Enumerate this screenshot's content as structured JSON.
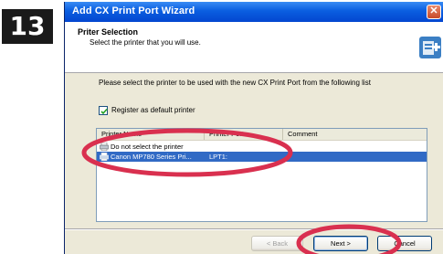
{
  "step": {
    "number": "13"
  },
  "window": {
    "title": "Add CX Print Port Wizard",
    "close_glyph": "✕"
  },
  "header": {
    "title": "Priter Selection",
    "subtitle": "Select the printer that you will use.",
    "icon": "wizard-printer-icon"
  },
  "instruction": "Please select the printer to be used with the new CX Print Port from the following list",
  "default_checkbox": {
    "checked": true,
    "label": "Register as default printer"
  },
  "printer_list": {
    "columns": [
      "Printer Name",
      "Printer Port",
      "Comment"
    ],
    "rows": [
      {
        "name": "Do not select the printer",
        "port": "",
        "comment": "",
        "selected": false,
        "icon": "printer-icon"
      },
      {
        "name": "Canon MP780 Series Pri...",
        "port": "LPT1:",
        "comment": "",
        "selected": true,
        "icon": "printer-icon"
      }
    ]
  },
  "buttons": {
    "back": "< Back",
    "next": "Next >",
    "cancel": "Cancel"
  },
  "colors": {
    "titlebar": "#0a5ee0",
    "selection": "#316ac5",
    "annotation": "#d9304f",
    "dialog_face": "#ece9d8"
  }
}
